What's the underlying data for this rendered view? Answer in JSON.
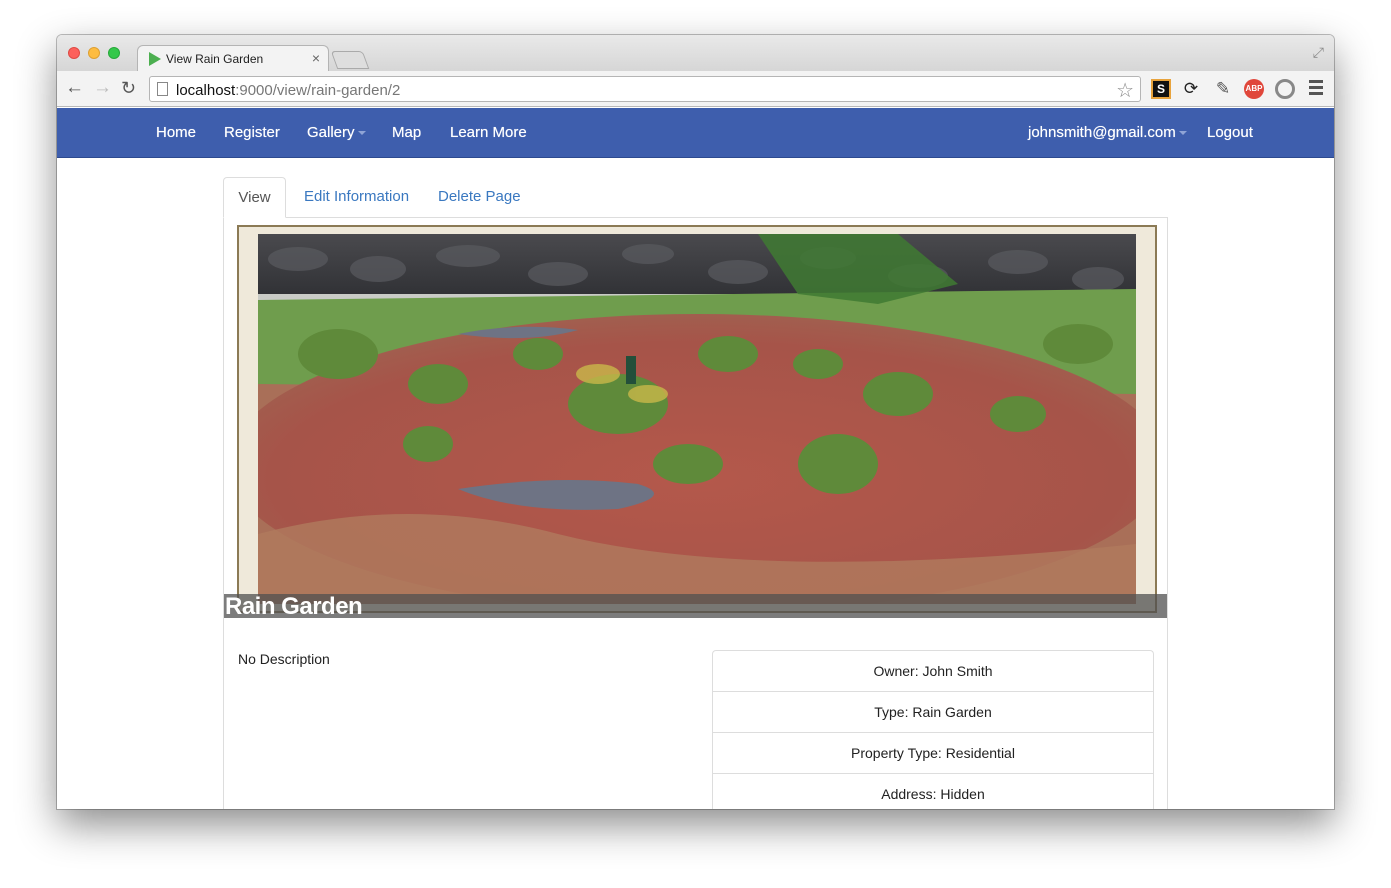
{
  "browser": {
    "tab_title": "View Rain Garden",
    "url_host": "localhost",
    "url_path": ":9000/view/rain-garden/2",
    "extension_abp": "ABP",
    "extension_s": "S"
  },
  "nav": {
    "home": "Home",
    "register": "Register",
    "gallery": "Gallery",
    "map": "Map",
    "learn_more": "Learn More",
    "user": "johnsmith@gmail.com",
    "logout": "Logout",
    "bar_color": "#3e5ead"
  },
  "page_tabs": {
    "view": "View",
    "edit": "Edit Information",
    "delete": "Delete Page"
  },
  "garden": {
    "title": "Rain Garden",
    "description": "No Description",
    "info": [
      "Owner: John Smith",
      "Type: Rain Garden",
      "Property Type: Residential",
      "Address: Hidden"
    ]
  }
}
